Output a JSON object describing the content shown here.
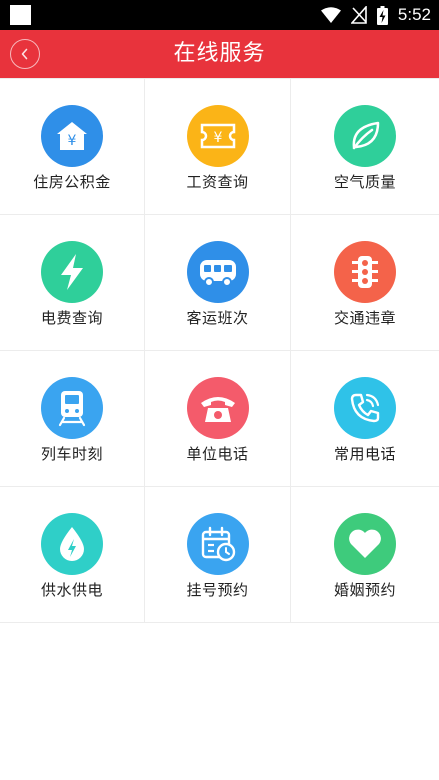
{
  "status_bar": {
    "time": "5:52",
    "icons": [
      "notification-square-icon",
      "wifi-icon",
      "no-sim-icon",
      "battery-charging-icon"
    ]
  },
  "header": {
    "title": "在线服务",
    "back_icon": "chevron-left-icon",
    "color": "#e8333c"
  },
  "services": [
    {
      "label": "住房公积金",
      "icon": "house-yen-icon",
      "color": "#2f8fe8"
    },
    {
      "label": "工资查询",
      "icon": "ticket-yen-icon",
      "color": "#fbb417"
    },
    {
      "label": "空气质量",
      "icon": "leaf-icon",
      "color": "#2fcf9a"
    },
    {
      "label": "电费查询",
      "icon": "lightning-icon",
      "color": "#2fcf9a"
    },
    {
      "label": "客运班次",
      "icon": "bus-icon",
      "color": "#2f8fe8"
    },
    {
      "label": "交通违章",
      "icon": "traffic-light-icon",
      "color": "#f4634a"
    },
    {
      "label": "列车时刻",
      "icon": "train-icon",
      "color": "#3aa4f0"
    },
    {
      "label": "单位电话",
      "icon": "telephone-icon",
      "color": "#f45b6b"
    },
    {
      "label": "常用电话",
      "icon": "phone-call-icon",
      "color": "#2fc2e8"
    },
    {
      "label": "供水供电",
      "icon": "water-drop-bolt-icon",
      "color": "#2fcfc8"
    },
    {
      "label": "挂号预约",
      "icon": "calendar-clock-icon",
      "color": "#3aa4f0"
    },
    {
      "label": "婚姻预约",
      "icon": "heart-icon",
      "color": "#3ecb7c"
    }
  ]
}
